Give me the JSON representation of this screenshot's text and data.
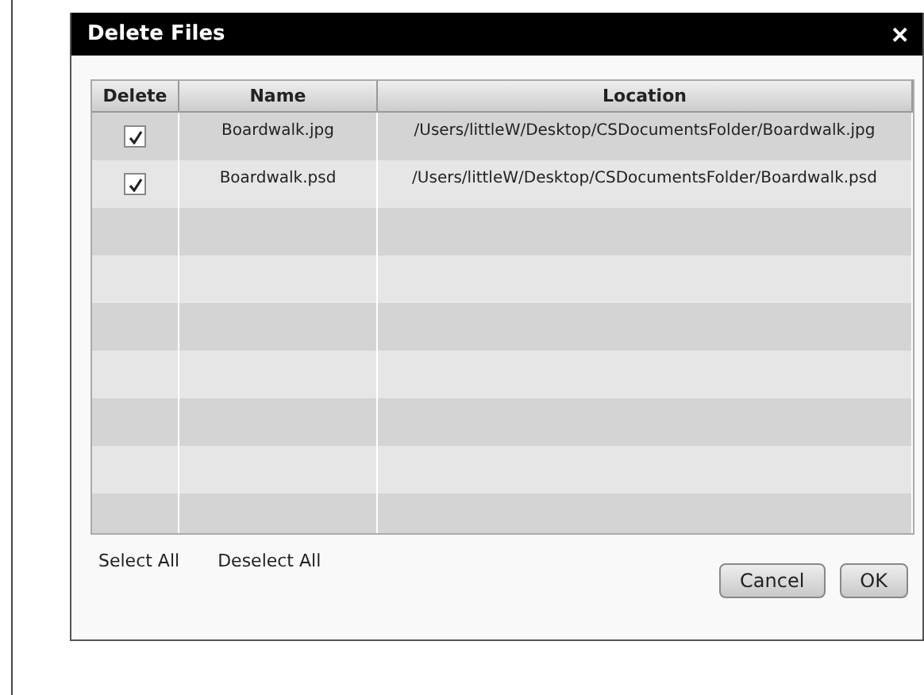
{
  "window": {
    "title": "Delete Files",
    "close": "✕"
  },
  "table": {
    "columns": [
      "Delete",
      "Name",
      "Location"
    ],
    "rows": [
      {
        "checked": true,
        "name": "Boardwalk.jpg",
        "location": "/Users/littleW/Desktop/CSDocumentsFolder/Boardwalk.jpg"
      },
      {
        "checked": true,
        "name": "Boardwalk.psd",
        "location": "/Users/littleW/Desktop/CSDocumentsFolder/Boardwalk.psd"
      }
    ]
  },
  "links": [
    "Select All",
    "Deselect All"
  ],
  "buttons": [
    "Cancel",
    "OK"
  ]
}
